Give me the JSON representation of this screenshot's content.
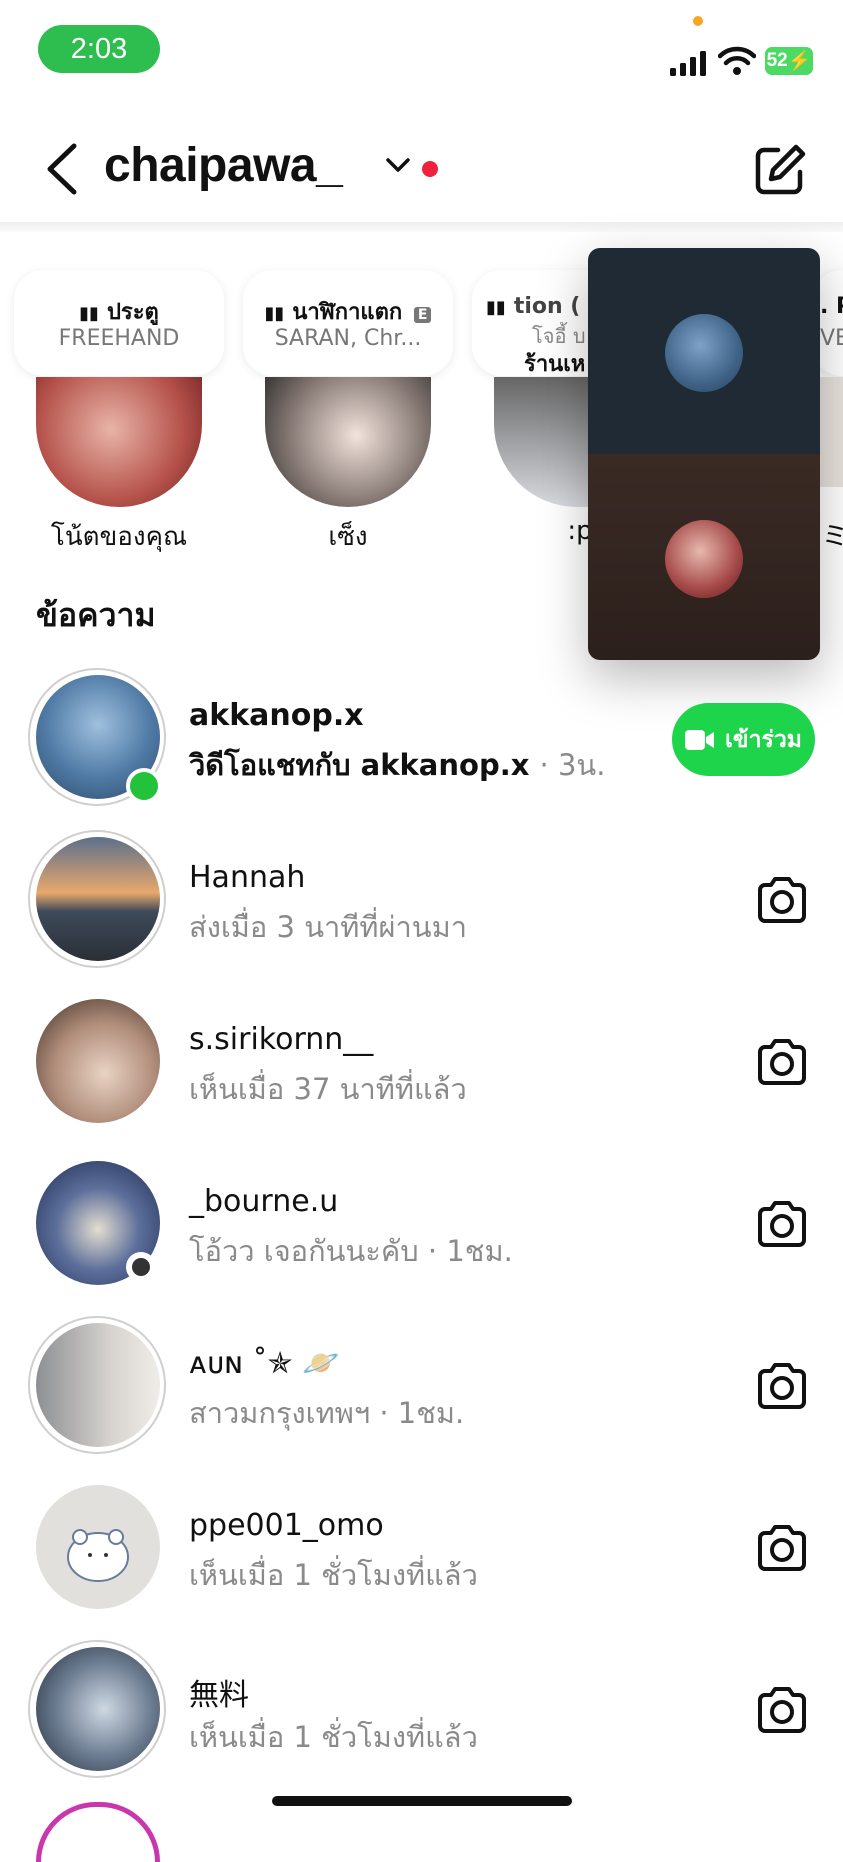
{
  "status": {
    "time": "2:03",
    "battery": "52"
  },
  "header": {
    "account": "chaipawa_"
  },
  "notes": [
    {
      "title": "ประตู",
      "subtitle": "FREEHAND"
    },
    {
      "title": "นาฬิกาแตก",
      "explicit": "E",
      "subtitle": "SARAN, Chr..."
    },
    {
      "title": "tion (",
      "line2": "โจอี้ บ",
      "line3": "ร้านเห"
    },
    {
      "title": ". P",
      "subtitle": "VE"
    }
  ],
  "stories": [
    {
      "name": "โน้ตของคุณ"
    },
    {
      "name": "เซ็ง"
    },
    {
      "name": ":p"
    },
    {
      "name": "ミ"
    }
  ],
  "section_title": "ข้อความ",
  "messages": [
    {
      "name": "akkanop.x",
      "preview": "วิดีโอแชทกับ akkanop.x",
      "time": "· 3น.",
      "action": "เข้าร่วม",
      "online": true
    },
    {
      "name": "Hannah",
      "preview": "ส่งเมื่อ 3 นาทีที่ผ่านมา"
    },
    {
      "name": "s.sirikornn__",
      "preview": "เห็นเมื่อ 37 นาทีที่แล้ว"
    },
    {
      "name": "_bourne.u",
      "preview": "โอ้วว เจอกันนะคับ · 1ชม."
    },
    {
      "name": "ᴀᴜɴ ˚✯ 🪐",
      "preview": "สาวมกรุงเทพฯ · 1ชม."
    },
    {
      "name": "ppe001_omo",
      "preview": "เห็นเมื่อ 1 ชั่วโมงที่แล้ว"
    },
    {
      "name": "無料",
      "preview": "เห็นเมื่อ 1 ชั่วโมงที่แล้ว"
    }
  ],
  "colors": {
    "online": "#22c33a",
    "join": "#1ed44a",
    "unread_dot": "#f0213d"
  }
}
